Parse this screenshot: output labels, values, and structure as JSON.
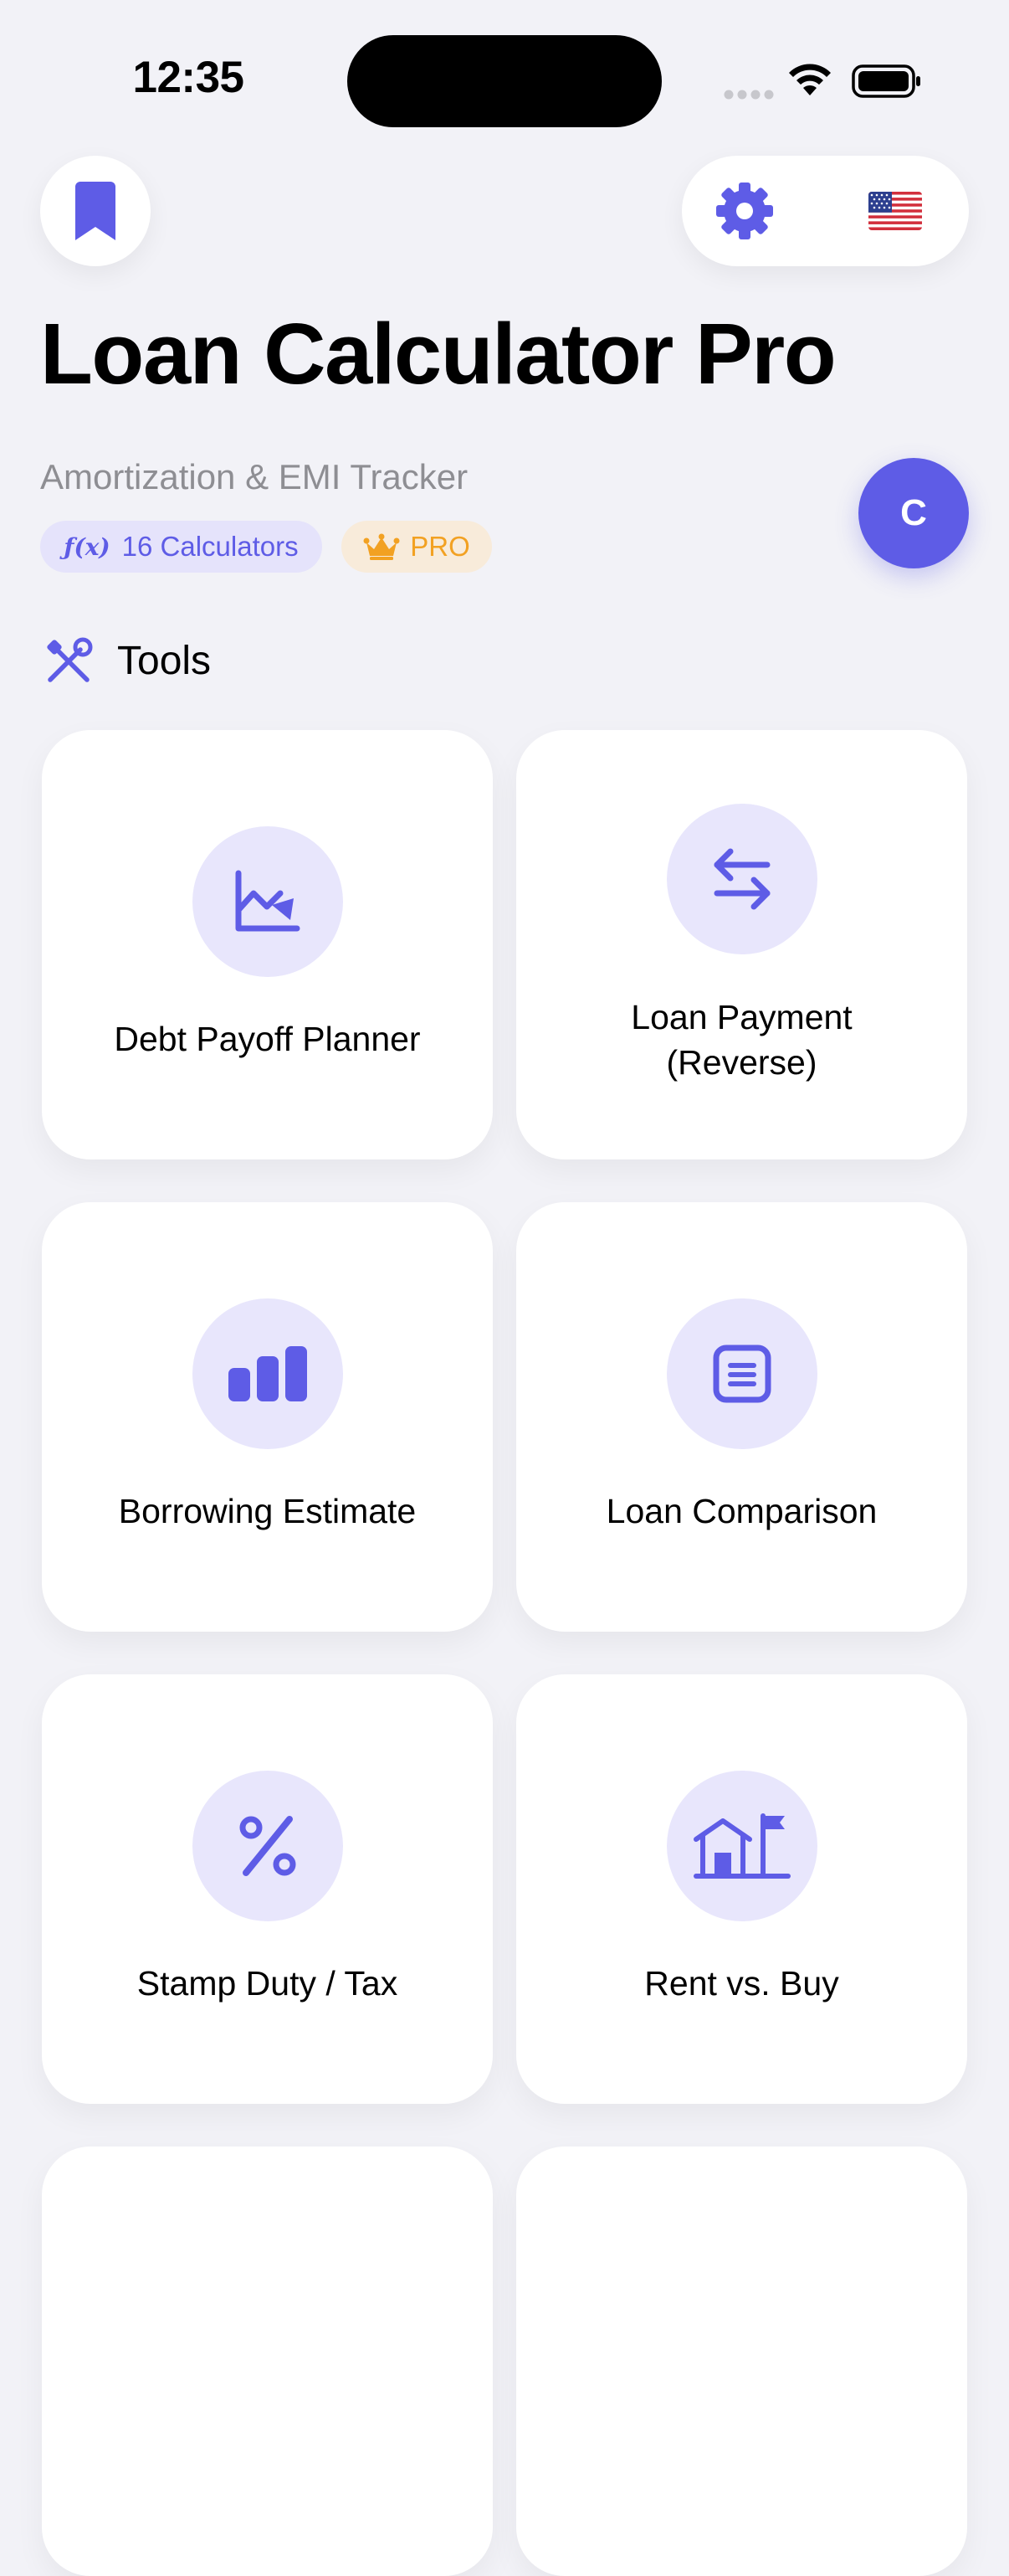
{
  "status_bar": {
    "time": "12:35"
  },
  "header": {
    "bookmark_icon": "bookmark-icon",
    "settings_icon": "gear-icon",
    "flag": "🇺🇸",
    "title": "Loan Calculator Pro",
    "subtitle": "Amortization & EMI Tracker",
    "calculators_badge": {
      "symbol": "ƒ(x)",
      "label": "16 Calculators"
    },
    "pro_badge": "PRO",
    "avatar_initial": "C"
  },
  "section": {
    "icon": "tools-icon",
    "title": "Tools"
  },
  "tools": [
    {
      "label": "Debt Payoff Planner",
      "icon": "chart-down-icon"
    },
    {
      "label": "Loan Payment\n(Reverse)",
      "icon": "arrows-swap-icon"
    },
    {
      "label": "Borrowing Estimate",
      "icon": "bar-chart-icon"
    },
    {
      "label": "Loan Comparison",
      "icon": "document-icon"
    },
    {
      "label": "Stamp Duty / Tax",
      "icon": "percent-icon"
    },
    {
      "label": "Rent vs. Buy",
      "icon": "house-flag-icon"
    }
  ],
  "colors": {
    "accent": "#5e5ce6",
    "pro": "#f2a122",
    "background": "#f2f2f7"
  }
}
